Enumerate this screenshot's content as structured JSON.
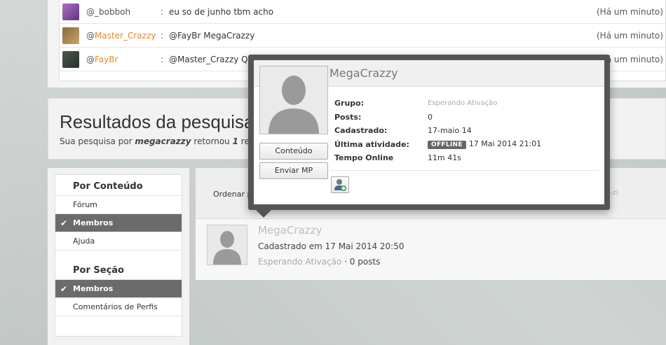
{
  "shoutbox": {
    "rows": [
      {
        "at": "@",
        "user": "_bobboh",
        "sep": ":",
        "message": "eu so de junho tbm acho",
        "time": "(Há um minuto)"
      },
      {
        "at": "@",
        "user": "Master_Crazzy",
        "sep": ":",
        "message": "@FayBr MegaCrazzy",
        "time": "(Há um minuto)"
      },
      {
        "at": "@",
        "user": "FayBr",
        "sep": ":",
        "message": "@Master_Crazzy Qual era sua antiga conta?",
        "time": "(Há um minuto)"
      }
    ]
  },
  "results_header": {
    "title": "Resultados da pesquisa",
    "sub_prefix": "Sua pesquisa por ",
    "query": "megacrazzy",
    "sub_middle": " retornou ",
    "count": "1",
    "sub_suffix": " resultado"
  },
  "sidebar": {
    "content_heading": "Por Conteúdo",
    "content_items": [
      {
        "label": "Fórum",
        "active": false
      },
      {
        "label": "Membros",
        "active": true
      },
      {
        "label": "Ajuda",
        "active": false
      }
    ],
    "section_heading": "Por Seção",
    "section_items": [
      {
        "label": "Membros",
        "active": true
      },
      {
        "label": "Comentários de Perfis",
        "active": false
      }
    ]
  },
  "sort": {
    "label": "Ordenar por",
    "az": "(a-z)"
  },
  "result": {
    "name": "MegaCrazzy",
    "registered": "Cadastrado em 17 Mai 2014 20:50",
    "group": "Esperando Ativação",
    "posts": " · 0 posts"
  },
  "hovercard": {
    "name": "MegaCrazzy",
    "content_button": "Conteúdo",
    "pm_button": "Enviar MP",
    "fields": {
      "group_label": "Grupo:",
      "group_value": "Esperando Ativação",
      "posts_label": "Posts:",
      "posts_value": "0",
      "registered_label": "Cadastrado:",
      "registered_value": "17-maio 14",
      "last_activity_label": "Última atividade:",
      "status_badge": "OFFLINE",
      "last_activity_value": "17 Mai 2014 21:01",
      "online_label": "Tempo Online",
      "online_value": "11m 41s"
    }
  },
  "colors": {
    "orange_user": "#e58a2a",
    "active_filter": "#6b6b6b",
    "popup_frame": "#555555"
  }
}
